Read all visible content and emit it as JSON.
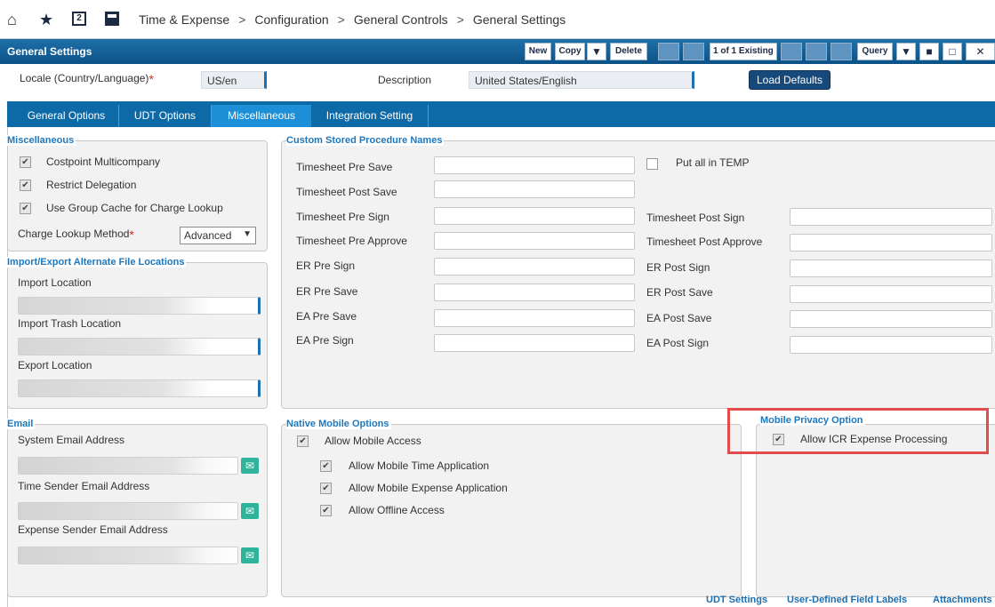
{
  "nav": {
    "badge": "2",
    "breadcrumb": [
      "Time & Expense",
      "Configuration",
      "General Controls",
      "General Settings"
    ],
    "separator": ">"
  },
  "titlebar": {
    "title": "General Settings",
    "new_label": "New",
    "copy_label": "Copy",
    "delete_label": "Delete",
    "record_count": "1 of 1 Existing",
    "query_label": "Query"
  },
  "header": {
    "locale_label": "Locale (Country/Language)",
    "locale_value": "US/en",
    "description_label": "Description",
    "description_value": "United States/English",
    "load_defaults_label": "Load Defaults"
  },
  "tabs": [
    {
      "label": "General Options",
      "active": false
    },
    {
      "label": "UDT Options",
      "active": false
    },
    {
      "label": "Miscellaneous",
      "active": true
    },
    {
      "label": "Integration Setting",
      "active": false
    }
  ],
  "misc": {
    "title": "Miscellaneous",
    "costpoint_multicompany": "Costpoint Multicompany",
    "restrict_delegation": "Restrict Delegation",
    "group_cache": "Use Group Cache for Charge Lookup",
    "charge_lookup_label": "Charge Lookup Method",
    "charge_lookup_value": "Advanced"
  },
  "file_locations": {
    "title": "Import/Export Alternate File Locations",
    "import_label": "Import Location",
    "import_trash_label": "Import Trash Location",
    "export_label": "Export Location"
  },
  "email": {
    "title": "Email",
    "system_label": "System Email Address",
    "time_sender_label": "Time Sender Email Address",
    "expense_sender_label": "Expense Sender Email Address"
  },
  "procs": {
    "title": "Custom Stored Procedure Names",
    "put_all_temp": "Put all in TEMP",
    "left": [
      "Timesheet Pre Save",
      "Timesheet Post Save",
      "Timesheet Pre Sign",
      "Timesheet Pre Approve",
      "ER Pre Sign",
      "ER Pre Save",
      "EA Pre Save",
      "EA Pre Sign"
    ],
    "right": [
      "Timesheet Post Sign",
      "Timesheet Post Approve",
      "ER Post Sign",
      "ER Post Save",
      "EA Post Save",
      "EA Post Sign"
    ]
  },
  "mobile": {
    "title": "Native Mobile Options",
    "allow_mobile_access": "Allow Mobile Access",
    "allow_time": "Allow Mobile Time Application",
    "allow_expense": "Allow Mobile Expense Application",
    "allow_offline": "Allow Offline Access"
  },
  "privacy": {
    "title": "Mobile Privacy Option",
    "allow_icr": "Allow ICR Expense Processing"
  },
  "footer_links": {
    "udt_settings": "UDT Settings",
    "udf_labels": "User-Defined Field Labels",
    "attachments": "Attachments"
  },
  "colors": {
    "accent": "#0d6aa7",
    "active_tab": "#1d8fd6",
    "highlight": "#e24c4c",
    "mail_icon": "#2fb39a"
  }
}
